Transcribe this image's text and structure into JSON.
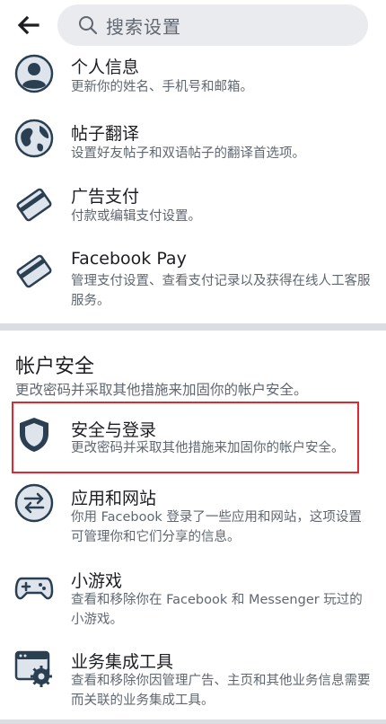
{
  "search": {
    "placeholder": "搜索设置"
  },
  "items": [
    {
      "title": "个人信息",
      "desc": "更新你的姓名、手机号和邮箱。"
    },
    {
      "title": "帖子翻译",
      "desc": "设置好友帖子和双语帖子的翻译首选项。"
    },
    {
      "title": "广告支付",
      "desc": "付款或编辑支付设置。"
    },
    {
      "title": "Facebook Pay",
      "desc": "管理支付设置、查看支付记录以及获得在线人工客服服务。"
    }
  ],
  "section": {
    "title": "帐户安全",
    "subtitle": "更改密码并采取其他措施来加固你的帐户安全。"
  },
  "security_items": [
    {
      "title": "安全与登录",
      "desc": "更改密码并采取其他措施来加固你的帐户安全。"
    },
    {
      "title": "应用和网站",
      "desc": "你用 Facebook 登录了一些应用和网站，这项设置可管理你和它们分享的信息。"
    },
    {
      "title": "小游戏",
      "desc": "查看和移除你在 Facebook 和 Messenger 玩过的小游戏。"
    },
    {
      "title": "业务集成工具",
      "desc": "查看和移除你因管理广告、主页和其他业务信息需要而关联的业务集成工具。"
    }
  ],
  "icons": {
    "back": "back-arrow-icon",
    "search": "search-icon",
    "personal_info": "person-icon",
    "translation": "globe-icon",
    "ad_payment": "credit-card-icon",
    "facebook_pay": "credit-card-icon",
    "security": "shield-icon",
    "apps": "swap-arrows-icon",
    "games": "gamepad-icon",
    "business": "settings-window-icon"
  },
  "colors": {
    "highlight": "#e0282e",
    "icon_dark": "#2b3f53",
    "icon_light": "#dde4ec"
  }
}
